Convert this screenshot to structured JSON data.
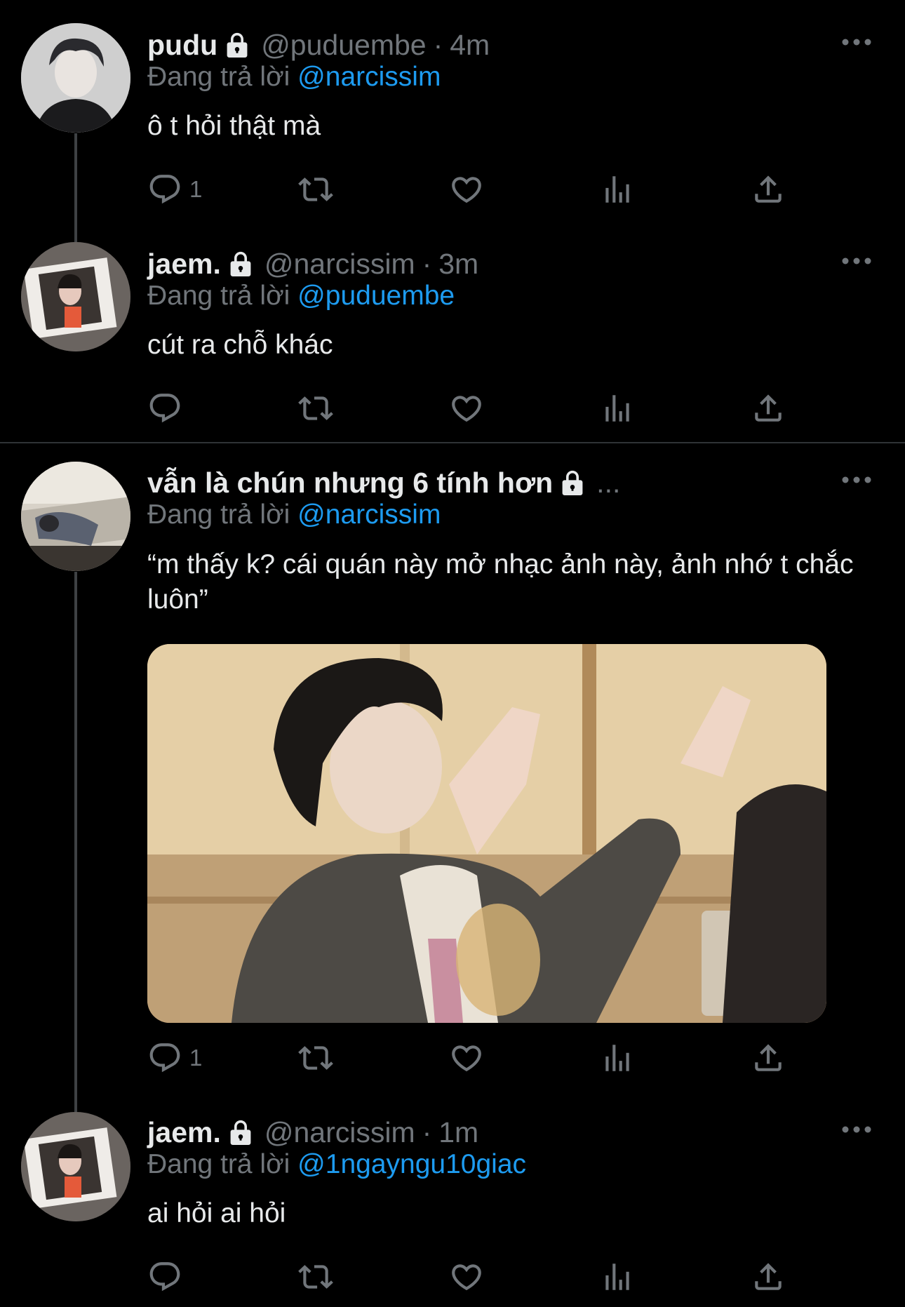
{
  "tweets": [
    {
      "name": "pudu",
      "handle": "@puduembe",
      "dot": "·",
      "time": "4m",
      "reply_prefix": "Đang trả lời",
      "reply_to": "@narcissim",
      "text": "ô t hỏi thật mà",
      "reply_count": "1"
    },
    {
      "name": "jaem.",
      "handle": "@narcissim",
      "dot": "·",
      "time": "3m",
      "reply_prefix": "Đang trả lời",
      "reply_to": "@puduembe",
      "text": "cút ra chỗ khác",
      "reply_count": ""
    },
    {
      "name": "vẫn là chún nhưng 6 tính hơn",
      "handle_ellipsis": "...",
      "reply_prefix": "Đang trả lời",
      "reply_to": "@narcissim",
      "text": "“m thấy k? cái quán này mở nhạc ảnh này, ảnh nhớ t chắc luôn”",
      "reply_count": "1"
    },
    {
      "name": "jaem.",
      "handle": "@narcissim",
      "dot": "·",
      "time": "1m",
      "reply_prefix": "Đang trả lời",
      "reply_to": "@1ngayngu10giac",
      "text": "ai hỏi ai hỏi",
      "reply_count": ""
    }
  ],
  "icons": {
    "reply": "reply-icon",
    "retweet": "retweet-icon",
    "like": "like-icon",
    "views": "views-icon",
    "share": "share-icon",
    "lock": "lock-icon",
    "more": "more-icon"
  },
  "colors": {
    "background": "#000000",
    "text": "#e7e9ea",
    "muted": "#71767b",
    "mention": "#1d9bf0",
    "divider": "#2f3336"
  }
}
